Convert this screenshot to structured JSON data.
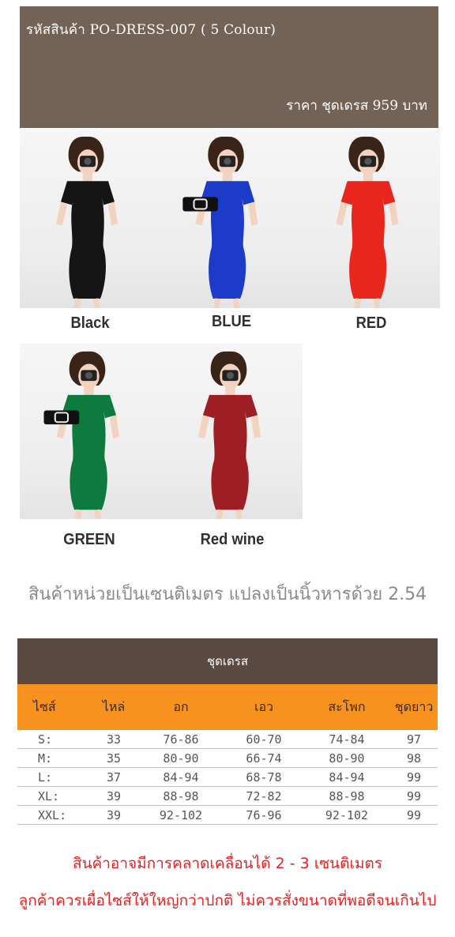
{
  "header": {
    "code": "รหัสสินค้า PO-DRESS-007 ( 5 Colour)",
    "price": "ราคา ชุดเดรส 959 บาท"
  },
  "products": [
    {
      "label": "Black",
      "dress_color": "#151515",
      "has_clutch": false
    },
    {
      "label": "BLUE",
      "dress_color": "#1c3bc8",
      "has_clutch": true
    },
    {
      "label": "RED",
      "dress_color": "#e8261c",
      "has_clutch": false
    },
    {
      "label": "GREEN",
      "dress_color": "#0f7a3e",
      "has_clutch": true
    },
    {
      "label": "Red wine",
      "dress_color": "#9d1f24",
      "has_clutch": false
    }
  ],
  "unit_note": "สินค้าหน่วยเป็นเซนติเมตร แปลงเป็นนิ้วหารด้วย 2.54",
  "size_table": {
    "title": "ชุดเดรส",
    "columns": [
      "ไซส์",
      "ไหล่",
      "อก",
      "เอว",
      "สะโพก",
      "ชุดยาว"
    ],
    "rows": [
      [
        "S:",
        "33",
        "76-86",
        "60-70",
        "74-84",
        "97"
      ],
      [
        "M:",
        "35",
        "80-90",
        "66-74",
        "80-90",
        "98"
      ],
      [
        "L:",
        "37",
        "84-94",
        "68-78",
        "84-94",
        "99"
      ],
      [
        "XL:",
        "39",
        "88-98",
        "72-82",
        "88-98",
        "99"
      ],
      [
        "XXL:",
        "39",
        "92-102",
        "76-96",
        "92-102",
        "99"
      ]
    ]
  },
  "notes": [
    "สินค้าอาจมีการคลาดเคลื่อนได้ 2 - 3 เซนติเมตร",
    "ลูกค้าควรเผื่อไซส์ให้ใหญ่กว่าปกติ ไม่ควรสั่งขนาดที่พอดีจนเกินไป"
  ],
  "colors": {
    "header_bg": "#736357",
    "table_head_bg": "#5a4a42",
    "table_cols_bg": "#f7921e",
    "note_red": "#e52121"
  }
}
